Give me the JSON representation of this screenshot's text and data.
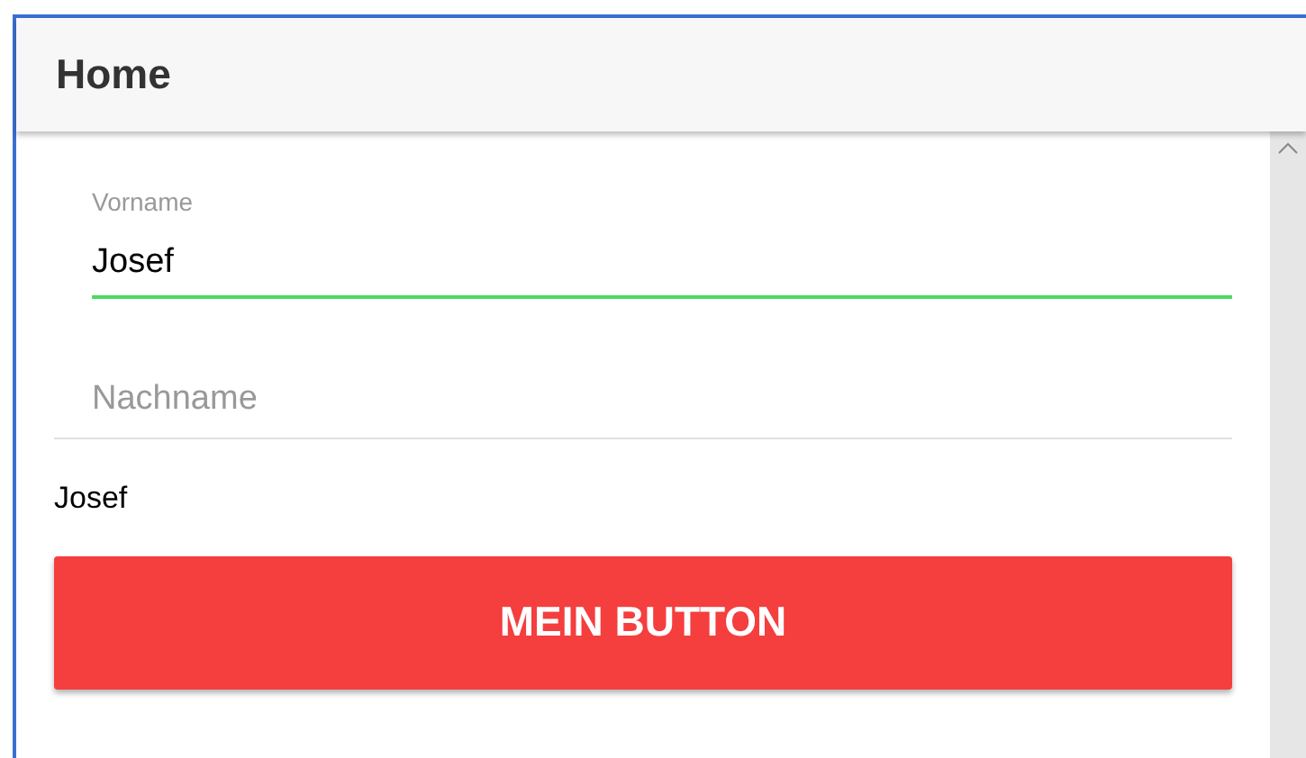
{
  "header": {
    "title": "Home"
  },
  "fields": [
    {
      "label": "Vorname",
      "value": "Josef",
      "focused": true
    },
    {
      "placeholder": "Nachname",
      "focused": false
    }
  ],
  "output_text": "Josef",
  "button": {
    "label": "MEIN BUTTON"
  }
}
